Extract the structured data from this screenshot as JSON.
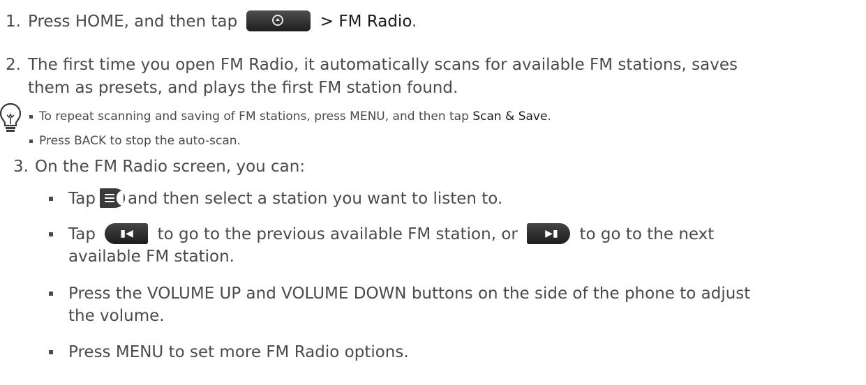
{
  "steps": {
    "s1_num": "1.",
    "s1_pre": "Press HOME, and then tap",
    "s1_ui": "> FM Radio",
    "s1_end": ".",
    "s2_num": "2.",
    "s2_line1": "The first time you open FM Radio, it automatically scans for available FM stations, saves",
    "s2_line2": "them as presets, and plays the first FM station found.",
    "s3_num": "3.",
    "s3_text": "On the FM Radio screen, you can:"
  },
  "tips": {
    "tip1_pre": "To repeat scanning and saving of FM stations, press MENU, and then tap",
    "tip1_ui": "Scan & Save",
    "tip1_end": ".",
    "tip2": "Press BACK to stop the auto-scan."
  },
  "bullets": {
    "b1_pre": "Tap",
    "b1_post": "and then select a station you want to listen to.",
    "b2_pre": "Tap",
    "b2_mid": "to go to the previous available FM station, or",
    "b2_post": "to go to the next",
    "b2_line2": "available FM station.",
    "b3_line1": "Press the VOLUME UP and VOLUME DOWN buttons on the side of the phone to adjust",
    "b3_line2": "the volume.",
    "b4": "Press MENU to set more FM Radio options."
  },
  "icons": {
    "launcher": "all-apps-icon",
    "list": "station-list-icon",
    "prev": "previous-station-icon",
    "next": "next-station-icon",
    "tip": "light-bulb-icon"
  }
}
